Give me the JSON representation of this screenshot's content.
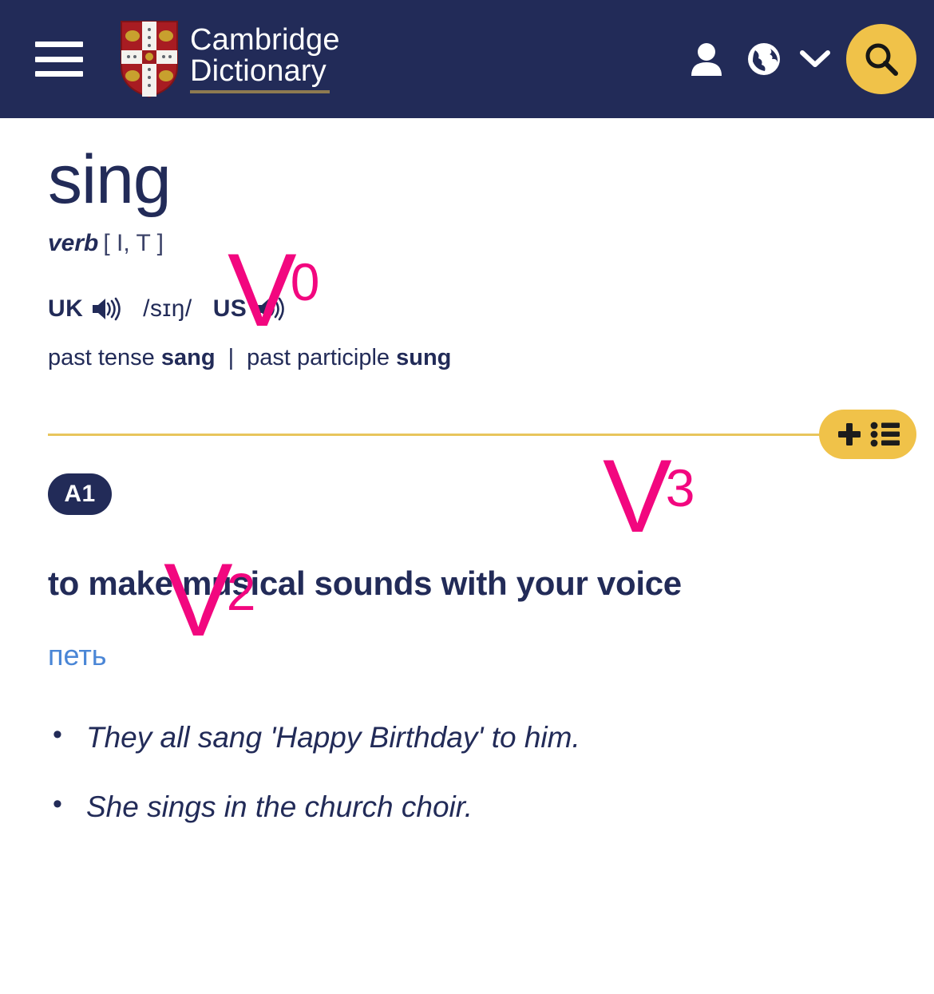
{
  "header": {
    "menu_icon": "hamburger-menu-icon",
    "brand_line1": "Cambridge",
    "brand_line2": "Dictionary",
    "crest_icon": "cambridge-crest-icon",
    "account_icon": "user-icon",
    "language_icon": "globe-icon",
    "language_chevron_icon": "chevron-down-icon",
    "search_icon": "search-icon",
    "background_color": "#222B58",
    "accent_color": "#F0C249"
  },
  "entry": {
    "headword": "sing",
    "part_of_speech": "verb",
    "grammar_codes": "[ I, T ]",
    "pronunciations": [
      {
        "region": "UK",
        "audio_icon": "speaker-icon"
      },
      {
        "region": "US",
        "audio_icon": "speaker-icon"
      }
    ],
    "ipa": "/sɪŋ/",
    "inflections": {
      "past_tense_label": "past tense",
      "past_tense_value": "sang",
      "separator": "|",
      "past_participle_label": "past participle",
      "past_participle_value": "sung"
    },
    "wordlist_button": {
      "plus_icon": "plus-icon",
      "list_icon": "list-icon"
    },
    "divider_color": "#E8C55C"
  },
  "sense": {
    "cefr_level": "A1",
    "definition": "to make musical sounds with your voice",
    "translation": "петь",
    "translation_color": "#4a86d6",
    "examples": [
      "They all sang 'Happy Birthday' to him.",
      "She sings in the church choir."
    ]
  },
  "annotations": {
    "color": "#F2077F",
    "markers": [
      {
        "letter": "V",
        "index": "0"
      },
      {
        "letter": "V",
        "index": "2"
      },
      {
        "letter": "V",
        "index": "3"
      }
    ]
  }
}
